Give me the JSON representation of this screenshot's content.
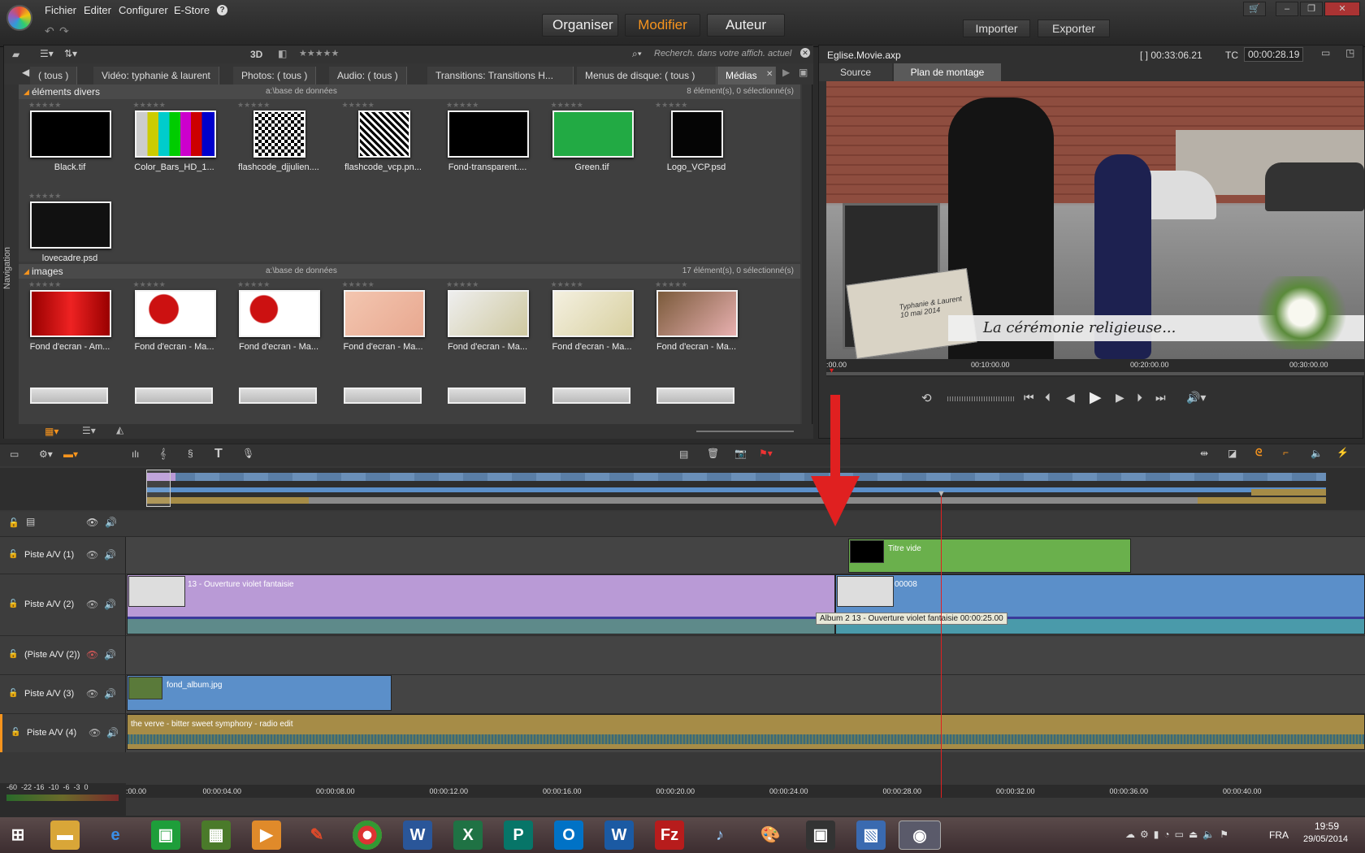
{
  "menu": {
    "file": "Fichier",
    "edit": "Editer",
    "config": "Configurer",
    "estore": "E-Store",
    "help": "?"
  },
  "modes": {
    "organise": "Organiser",
    "modify": "Modifier",
    "author": "Auteur"
  },
  "io": {
    "import": "Importer",
    "export": "Exporter"
  },
  "library": {
    "toolbar": {
      "three_d": "3D",
      "rating": "★★★★★",
      "search_placeholder": "Recherch. dans votre affich. actuel"
    },
    "tabs": [
      "( tous )",
      "Vidéo: typhanie & laurent",
      "Photos: ( tous )",
      "Audio: ( tous )",
      "Transitions: Transitions H...",
      "Menus de disque: ( tous )",
      "Médias"
    ],
    "nav_label": "Navigation",
    "sections": [
      {
        "title": "éléments divers",
        "path": "a:\\base de données",
        "count": "8 élément(s), 0 sélectionné(s)",
        "items": [
          "Black.tif",
          "Color_Bars_HD_1...",
          "flashcode_djjulien....",
          "flashcode_vcp.pn...",
          "Fond-transparent....",
          "Green.tif",
          "Logo_VCP.psd",
          "lovecadre.psd"
        ]
      },
      {
        "title": "images",
        "path": "a:\\base de données",
        "count": "17 élément(s), 0 sélectionné(s)",
        "items": [
          "Fond d'ecran - Am...",
          "Fond d'ecran - Ma...",
          "Fond d'ecran - Ma...",
          "Fond d'ecran - Ma...",
          "Fond d'ecran - Ma...",
          "Fond d'ecran - Ma...",
          "Fond d'ecran - Ma..."
        ]
      }
    ]
  },
  "preview": {
    "file": "Eglise.Movie.axp",
    "duration": "[ ] 00:33:06.21",
    "tc_label": "TC",
    "tc": "00:00:28.19",
    "tabs": [
      "Source",
      "Plan de montage"
    ],
    "title_overlay": "La cérémonie religieuse...",
    "book_text": "Typhanie & Laurent 10 mai 2014",
    "ruler": [
      ":00.00",
      "00:10:00.00",
      "00:20:00.00",
      "00:30:00.00"
    ]
  },
  "timeline": {
    "tracks": [
      {
        "name": "Piste A/V (1)",
        "clips": [
          {
            "label": "Titre vide"
          }
        ]
      },
      {
        "name": "Piste A/V (2)",
        "clips": [
          {
            "label": "13 - Ouverture violet fantaisie"
          },
          {
            "label": "00008"
          }
        ]
      },
      {
        "name": "(Piste A/V (2))",
        "clips": []
      },
      {
        "name": "Piste A/V (3)",
        "clips": [
          {
            "label": "fond_album.jpg"
          }
        ]
      },
      {
        "name": "Piste A/V (4)",
        "clips": [
          {
            "label": "the verve - bitter sweet symphony - radio edit"
          }
        ]
      }
    ],
    "tooltip": "Album 2  13 - Ouverture violet fantaisie  00:00:25.00",
    "ruler": [
      ":00.00",
      "00:00:04.00",
      "00:00:08.00",
      "00:00:12.00",
      "00:00:16.00",
      "00:00:20.00",
      "00:00:24.00",
      "00:00:28.00",
      "00:00:32.00",
      "00:00:36.00",
      "00:00:40.00"
    ],
    "meter": "-60  -22 -16  -10  -6  -3  0"
  },
  "taskbar": {
    "lang": "FRA",
    "time": "19:59",
    "date": "29/05/2014"
  },
  "colors": {
    "accent": "#f7941d",
    "purple_clip": "#b99ad6",
    "blue_clip": "#5b8fc9",
    "green_clip": "#6ab04c",
    "gold_clip": "#a68c47",
    "playhead": "#e02020"
  }
}
